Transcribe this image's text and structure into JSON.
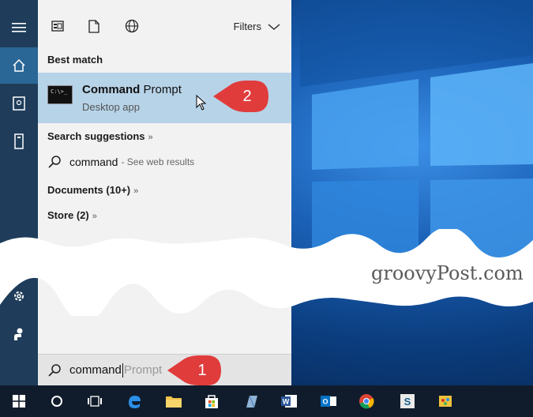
{
  "search_panel": {
    "filters_label": "Filters",
    "best_match": {
      "header": "Best match",
      "app_name_bold": "Command",
      "app_name_rest": " Prompt",
      "app_type": "Desktop app",
      "icon_text": "C:\\>_"
    },
    "suggestions_header": "Search suggestions",
    "suggestion": {
      "term": "command",
      "hint": "- See web results"
    },
    "documents": "Documents (10+)",
    "store": "Store (2)",
    "search_box": {
      "typed": "command",
      "ghost": "Prompt"
    }
  },
  "watermark": "groovyPost.com",
  "callouts": {
    "one": "1",
    "two": "2"
  },
  "colors": {
    "accent": "#2a6696",
    "highlight": "#b7d3e8",
    "callout": "#e03c3c"
  },
  "taskbar": {
    "items": [
      "start-icon",
      "cortana-icon",
      "task-view-icon",
      "edge-icon",
      "file-explorer-icon",
      "store-icon",
      "app-icon",
      "word-icon",
      "outlook-icon",
      "chrome-icon",
      "snagit-icon",
      "paint-icon"
    ]
  }
}
